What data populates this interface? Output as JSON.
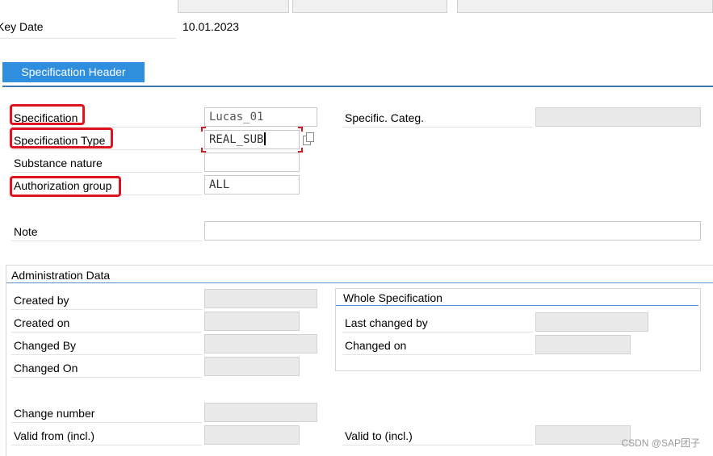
{
  "key_date": {
    "label": "Key Date",
    "value": "10.01.2023"
  },
  "tabs": [
    {
      "label": "Specification Header",
      "active": true
    }
  ],
  "header_fields": {
    "specification": {
      "label": "Specification",
      "value": "Lucas_01"
    },
    "specification_type": {
      "label": "Specification Type",
      "value": "REAL_SUB"
    },
    "substance_nature": {
      "label": "Substance nature",
      "value": ""
    },
    "authorization_group": {
      "label": "Authorization group",
      "value": "ALL"
    },
    "specific_categ": {
      "label": "Specific. Categ.",
      "value": ""
    },
    "note": {
      "label": "Note",
      "value": ""
    }
  },
  "administration": {
    "title": "Administration Data",
    "created_by": {
      "label": "Created by",
      "value": ""
    },
    "created_on": {
      "label": "Created on",
      "value": ""
    },
    "changed_by": {
      "label": "Changed By",
      "value": ""
    },
    "changed_on": {
      "label": "Changed On",
      "value": ""
    },
    "change_number": {
      "label": "Change number",
      "value": ""
    },
    "valid_from": {
      "label": "Valid from (incl.)",
      "value": ""
    },
    "valid_to": {
      "label": "Valid to (incl.)",
      "value": ""
    },
    "whole_spec": {
      "title": "Whole Specification",
      "last_changed_by": {
        "label": "Last changed by",
        "value": ""
      },
      "changed_on": {
        "label": "Changed on",
        "value": ""
      }
    }
  },
  "watermark": "CSDN @SAP团子",
  "colors": {
    "tab_active": "#2f8fde",
    "highlight": "#e0141e",
    "section_line": "#5a8ed6"
  }
}
